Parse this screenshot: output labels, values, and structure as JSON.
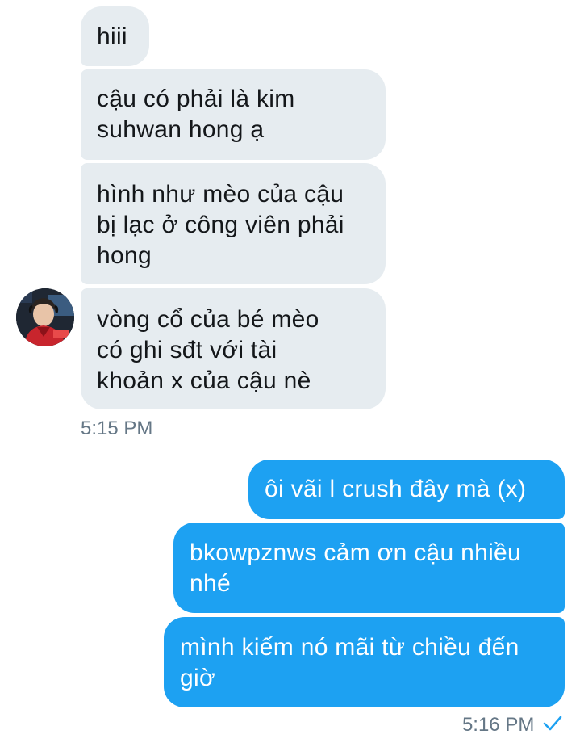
{
  "conversation": {
    "received": [
      {
        "lines": [
          "hiii"
        ]
      },
      {
        "lines": [
          "cậu có phải là kim",
          "suhwan hong ạ"
        ]
      },
      {
        "lines": [
          "hình như mèo của cậu",
          "bị lạc ở công viên phải",
          "hong"
        ]
      },
      {
        "lines": [
          "vòng cổ của bé mèo",
          "có ghi sđt với tài",
          "khoản x của cậu nè"
        ]
      }
    ],
    "received_time": "5:15 PM",
    "sent": [
      {
        "lines": [
          "ôi vãi l crush đây mà (x)"
        ]
      },
      {
        "lines": [
          "bkowpznws cảm ơn cậu nhiều",
          "nhé"
        ]
      },
      {
        "lines": [
          "mình kiếm nó mãi từ chiều đến",
          "giờ"
        ]
      }
    ],
    "sent_time": "5:16 PM",
    "sent_status_icon": "checkmark-icon",
    "avatar_icon": "user-avatar"
  },
  "colors": {
    "received_bubble": "#e6ecf0",
    "sent_bubble": "#1da1f2",
    "timestamp": "#657786",
    "check": "#1da1f2"
  }
}
